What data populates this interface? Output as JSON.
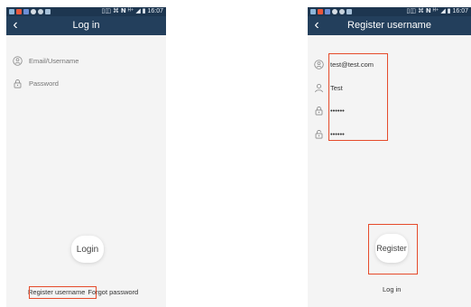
{
  "colors": {
    "statusbar": "#1d3650",
    "navbar": "#233f5c",
    "highlight": "#e54b2b",
    "background": "#f4f4f4"
  },
  "statusbar": {
    "left_icons": [
      "photo-icon",
      "app-icon",
      "mail-icon",
      "location-icon",
      "globe-icon",
      "image-icon"
    ],
    "right_text": "▯◫ ⌘ 𝗡 ᴴ⁺ ◢ ▮ 16:07"
  },
  "login_screen": {
    "title": "Log in",
    "email_placeholder": "Email/Username",
    "password_placeholder": "Password",
    "login_button": "Login",
    "register_link": "Register username",
    "forgot_link": "Forgot password"
  },
  "register_screen": {
    "title": "Register username",
    "email_value": "test@test.com",
    "name_value": "Test",
    "password_value": "••••••",
    "confirm_password_value": "••••••",
    "register_button": "Register",
    "login_link": "Log in"
  }
}
